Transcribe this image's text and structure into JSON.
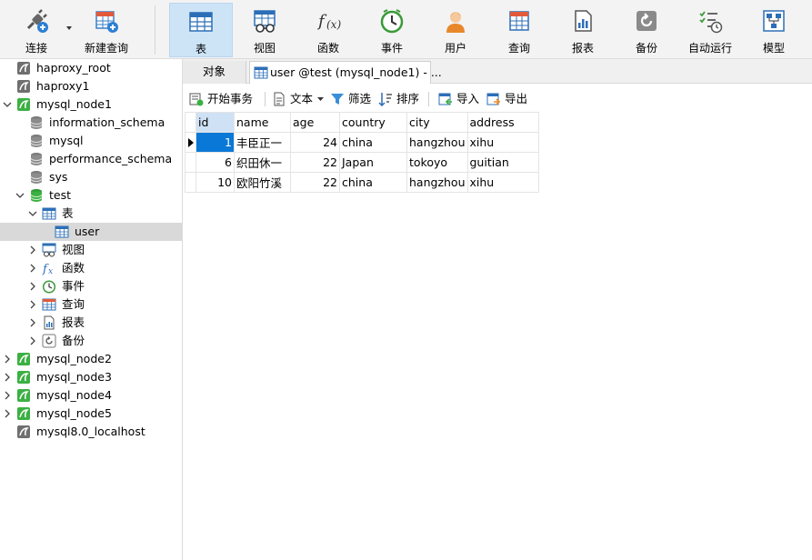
{
  "toolbar": {
    "connect": "连接",
    "new_query": "新建查询",
    "table": "表",
    "view": "视图",
    "function": "函数",
    "event": "事件",
    "user": "用户",
    "query": "查询",
    "report": "报表",
    "backup": "备份",
    "automation": "自动运行",
    "model": "模型"
  },
  "tree": {
    "haproxy_root": "haproxy_root",
    "haproxy1": "haproxy1",
    "mysql_node1": "mysql_node1",
    "information_schema": "information_schema",
    "mysql": "mysql",
    "performance_schema": "performance_schema",
    "sys": "sys",
    "test": "test",
    "tables": "表",
    "user": "user",
    "views": "视图",
    "functions": "函数",
    "events": "事件",
    "queries": "查询",
    "reports": "报表",
    "backups": "备份",
    "mysql_node2": "mysql_node2",
    "mysql_node3": "mysql_node3",
    "mysql_node4": "mysql_node4",
    "mysql_node5": "mysql_node5",
    "mysql80": "mysql8.0_localhost"
  },
  "tabs": {
    "objects": "对象",
    "user_tab": "user @test (mysql_node1) - ..."
  },
  "subbar": {
    "begin_tx": "开始事务",
    "text": "文本",
    "filter": "筛选",
    "sort": "排序",
    "import": "导入",
    "export": "导出"
  },
  "grid": {
    "columns": [
      "id",
      "name",
      "age",
      "country",
      "city",
      "address"
    ],
    "rows": [
      [
        "1",
        "丰臣正一",
        "24",
        "china",
        "hangzhou",
        "xihu"
      ],
      [
        "6",
        "织田休一",
        "22",
        "Japan",
        "tokoyo",
        "guitian"
      ],
      [
        "10",
        "欧阳竹溪",
        "22",
        "china",
        "hangzhou",
        "xihu"
      ]
    ]
  },
  "colors": {
    "mysql_green": "#3cb043",
    "selection_blue": "#0a78d7",
    "active_tab": "#cde4f7"
  }
}
